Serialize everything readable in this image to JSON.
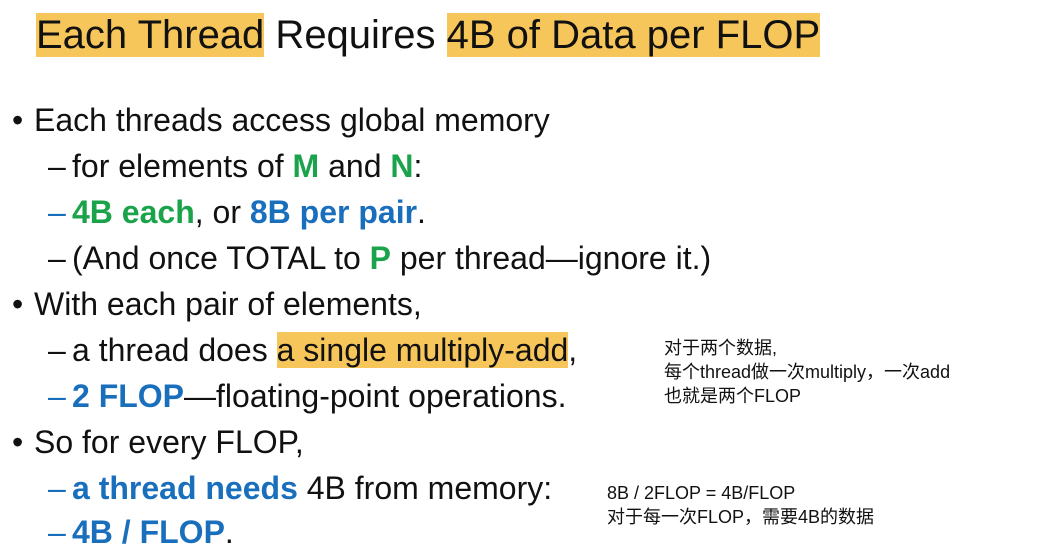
{
  "title": {
    "part1": "Each Thread",
    "part2": " Requires ",
    "part3": "4B of Data per FLOP"
  },
  "bullets": {
    "b1": "Each threads access global memory",
    "b1_s1": {
      "dash": "–",
      "pre": "for elements of ",
      "m": "M",
      "and": " and ",
      "n": "N",
      "post": ":"
    },
    "b1_s2": {
      "dash": "–",
      "a": "4B each",
      "mid": ", or ",
      "b": "8B per pair",
      "end": "."
    },
    "b1_s3": {
      "dash": "–",
      "pre": "(And once TOTAL to ",
      "p": "P",
      "post": " per thread—ignore it.)"
    },
    "b2": "With each pair of elements,",
    "b2_s1": {
      "dash": "–",
      "pre": "a thread does ",
      "hl": "a single multiply-add",
      "post": ","
    },
    "b2_s2": {
      "dash": "–",
      "a": "2 FLOP",
      "post": "—floating-point operations."
    },
    "b3": "So for every FLOP,",
    "b3_s1": {
      "dash": "–",
      "a": "a thread needs",
      "post": " 4B from memory:"
    },
    "b3_s2": {
      "dash": "–",
      "a": "4B / FLOP",
      "post": "."
    }
  },
  "notes": {
    "n1_l1": "对于两个数据,",
    "n1_l2": "每个thread做一次multiply，一次add",
    "n1_l3": "也就是两个FLOP",
    "n2_l1": "8B / 2FLOP = 4B/FLOP",
    "n2_l2": "对于每一次FLOP，需要4B的数据"
  },
  "colors": {
    "highlight": "#f7c65a",
    "green": "#1aa34a",
    "blue": "#1a6fbd"
  }
}
